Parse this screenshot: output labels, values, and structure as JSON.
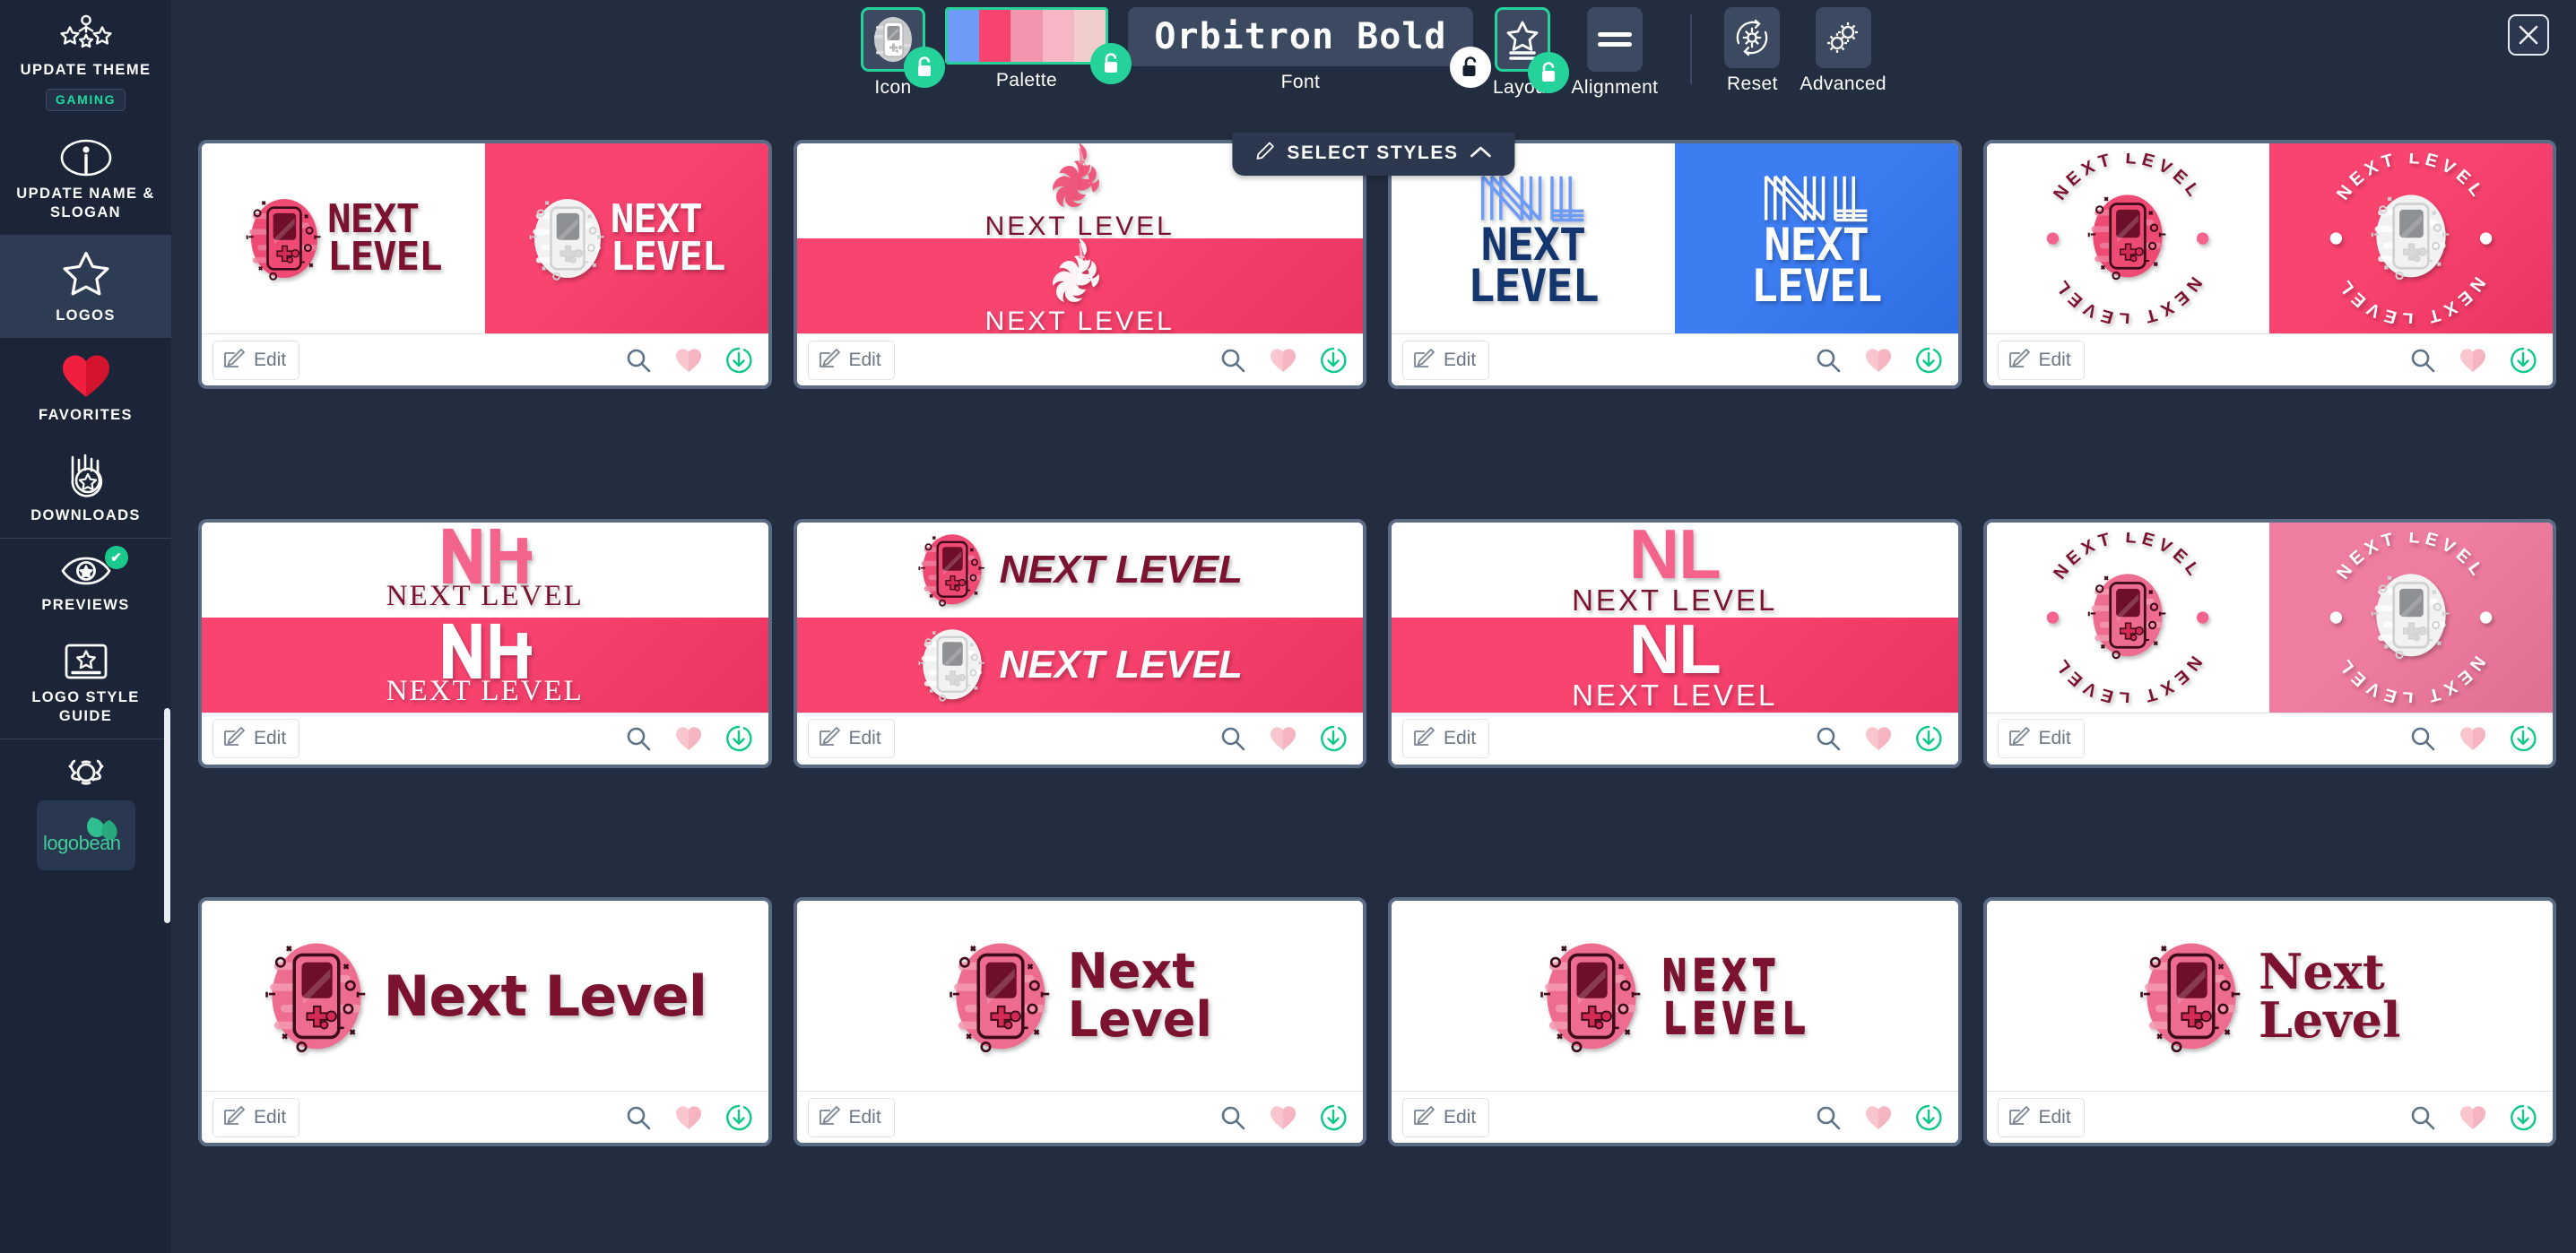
{
  "app": {
    "brand": "logobean"
  },
  "sidebar": {
    "items": [
      {
        "id": "update-theme",
        "label": "UPDATE THEME",
        "icon": "stars-people-icon",
        "badge": "GAMING",
        "active": false
      },
      {
        "id": "update-name",
        "label": "UPDATE NAME & SLOGAN",
        "icon": "info-circle-icon",
        "active": false
      },
      {
        "id": "logos",
        "label": "LOGOS",
        "icon": "star-outline-icon",
        "active": true
      },
      {
        "id": "favorites",
        "label": "FAVORITES",
        "icon": "heart-filled-icon",
        "active": false
      },
      {
        "id": "downloads",
        "label": "DOWNLOADS",
        "icon": "download-star-icon",
        "active": false
      },
      {
        "id": "previews",
        "label": "PREVIEWS",
        "icon": "eye-star-icon",
        "active": false,
        "check": "✔"
      },
      {
        "id": "logo-style-guide",
        "label": "LOGO STYLE GUIDE",
        "icon": "style-guide-icon",
        "active": false
      },
      {
        "id": "settings",
        "label": "",
        "icon": "gear-icon",
        "active": false
      }
    ]
  },
  "toolbar": {
    "items": [
      {
        "id": "icon",
        "label": "Icon",
        "kind": "icon",
        "selected": true,
        "lock": "locked"
      },
      {
        "id": "palette",
        "label": "Palette",
        "kind": "palette",
        "selected": true,
        "lock": "locked"
      },
      {
        "id": "font",
        "label": "Font",
        "kind": "font",
        "value": "Orbitron Bold",
        "selected": false,
        "lock": "unlocked"
      },
      {
        "id": "layout",
        "label": "Layout",
        "kind": "layout",
        "selected": true,
        "lock": "locked"
      },
      {
        "id": "alignment",
        "label": "Alignment",
        "kind": "align",
        "selected": false
      },
      {
        "id": "reset",
        "label": "Reset",
        "kind": "reset",
        "selected": false
      },
      {
        "id": "advanced",
        "label": "Advanced",
        "kind": "advanced",
        "selected": false
      }
    ],
    "palette_colors": [
      "#6d9bf7",
      "#f9446f",
      "#f294ae",
      "#f7b6c6",
      "#f1cdcd"
    ],
    "close_label": "✕"
  },
  "select_styles": {
    "label": "SELECT STYLES",
    "chevron": "⌃",
    "pencil": "pencil-icon"
  },
  "card_actions": {
    "edit_label": "Edit",
    "preview_icon": "magnifier-icon",
    "favorite_icon": "heart-icon",
    "download_icon": "download-circle-icon"
  },
  "colors": {
    "accent_green": "#25d39a",
    "pink": "#f9446f",
    "pink_light": "#f47195",
    "deep_maroon": "#7a1230",
    "navy": "#14366e",
    "blue": "#3d7df2",
    "sidebar_bg": "#1b2537",
    "page_bg": "#222d40",
    "card_border": "#5b6a85"
  },
  "brand_name": "NEXT LEVEL",
  "cards": [
    {
      "id": "c1",
      "split": "vertical",
      "style": "condensed-stack",
      "name_line1": "NEXT",
      "name_line2": "LEVEL",
      "mark": "gameboy",
      "light_bg": "#ffffff",
      "dark_bg": "#f9446f",
      "light_text": "#7a1230",
      "dark_text": "#ffffff"
    },
    {
      "id": "c2",
      "split": "horizontal",
      "style": "ornament-thin",
      "name": "NEXT LEVEL",
      "mark": "flourish",
      "light_bg": "#ffffff",
      "dark_bg": "#f9446f",
      "light_text": "#7a1230",
      "dark_text": "#ffffff"
    },
    {
      "id": "c3",
      "split": "vertical",
      "style": "monogram-stack",
      "monogram": "NL",
      "name_line1": "NEXT",
      "name_line2": "LEVEL",
      "mark": "nl-lines",
      "light_bg": "#ffffff",
      "dark_bg": "#3d7df2",
      "light_text": "#14366e",
      "dark_text": "#ffffff",
      "mono_light": "#6d9bf7",
      "mono_dark": "#ffffff"
    },
    {
      "id": "c4",
      "split": "vertical",
      "style": "circular-badge",
      "name": "NEXT LEVEL",
      "mark": "gameboy-badge",
      "light_bg": "#ffffff",
      "dark_bg": "#f9446f",
      "light_text": "#7a1230",
      "dark_text": "#ffffff"
    },
    {
      "id": "c5",
      "split": "horizontal",
      "style": "ligature-serif",
      "monogram": "NL",
      "name": "NEXT LEVEL",
      "mark": "nl-ligature",
      "light_bg": "#ffffff",
      "dark_bg": "#f9446f",
      "light_text": "#7a1230",
      "dark_text": "#ffffff",
      "mono_light": "#f4638c",
      "mono_dark": "#ffffff"
    },
    {
      "id": "c6",
      "split": "horizontal",
      "style": "icon-left-italic",
      "name": "NEXT LEVEL",
      "mark": "gameboy",
      "light_bg": "#ffffff",
      "dark_bg": "#f9446f",
      "light_text": "#7a1230",
      "dark_text": "#ffffff"
    },
    {
      "id": "c7",
      "split": "horizontal",
      "style": "monogram-thin",
      "monogram": "NL",
      "name": "NEXT LEVEL",
      "mark": "nl-plain",
      "light_bg": "#ffffff",
      "dark_bg": "#f9446f",
      "light_text": "#7a1230",
      "dark_text": "#ffffff",
      "mono_light": "#f4638c",
      "mono_dark": "#ffffff"
    },
    {
      "id": "c8",
      "split": "vertical",
      "style": "circular-badge",
      "name": "NEXT LEVEL",
      "mark": "gameboy-badge",
      "light_bg": "#ffffff",
      "dark_bg": "#ef7d9f",
      "light_text": "#7a1230",
      "dark_text": "#ffffff"
    },
    {
      "id": "c9",
      "split": "none",
      "style": "icon-left-heavy",
      "name": "Next Level",
      "mark": "gameboy-tall",
      "light_bg": "#ffffff",
      "light_text": "#7a1230"
    },
    {
      "id": "c10",
      "split": "none",
      "style": "icon-left-stack",
      "name_line1": "Next",
      "name_line2": "Level",
      "mark": "gameboy-tall",
      "light_bg": "#ffffff",
      "light_text": "#7a1230"
    },
    {
      "id": "c11",
      "split": "none",
      "style": "pixel-stack",
      "name_line1": "NEXT",
      "name_line2": "LEVEL",
      "mark": "gameboy-tall",
      "light_bg": "#ffffff",
      "light_text": "#7a1230"
    },
    {
      "id": "c12",
      "split": "none",
      "style": "icon-left-stack-serif",
      "name_line1": "Next",
      "name_line2": "Level",
      "mark": "gameboy-tall",
      "light_bg": "#ffffff",
      "light_text": "#7a1230"
    }
  ]
}
